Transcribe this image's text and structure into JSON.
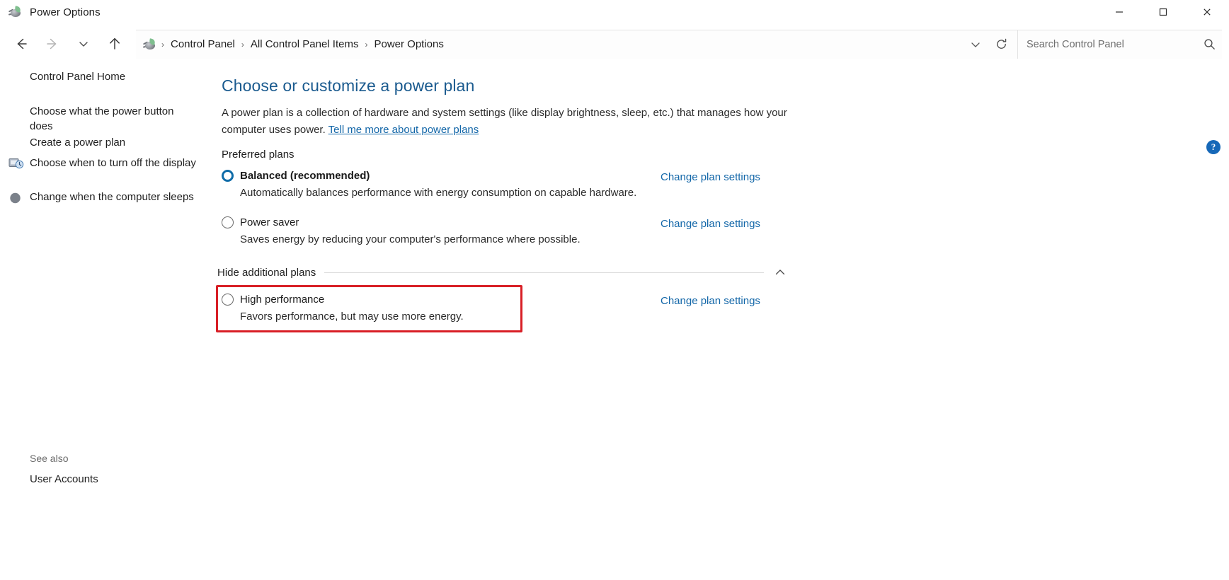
{
  "window": {
    "title": "Power Options",
    "app_icon": "power-plug-icon",
    "controls": {
      "minimize": "—",
      "maximize": "☐",
      "close": "✕"
    }
  },
  "navbar": {
    "back": "back-arrow",
    "forward": "forward-arrow",
    "recent": "chevron-down",
    "up": "up-arrow",
    "breadcrumbs": [
      "Control Panel",
      "All Control Panel Items",
      "Power Options"
    ],
    "separator": "›",
    "history_dropdown": "chevron-down",
    "refresh": "refresh-icon"
  },
  "search": {
    "placeholder": "Search Control Panel",
    "value": "",
    "icon": "search-icon"
  },
  "sidebar": {
    "home": "Control Panel Home",
    "items": [
      {
        "label": "Choose what the power button does",
        "icon": null
      },
      {
        "label": "Create a power plan",
        "icon": null
      },
      {
        "label": "Choose when to turn off the display",
        "icon": "display-shield-icon"
      },
      {
        "label": "Change when the computer sleeps",
        "icon": "moon-icon"
      }
    ],
    "see_also_label": "See also",
    "see_also_links": [
      "User Accounts"
    ]
  },
  "main": {
    "title": "Choose or customize a power plan",
    "description_prefix": "A power plan is a collection of hardware and system settings (like display brightness, sleep, etc.) that manages how your computer uses power. ",
    "description_link": "Tell me more about power plans",
    "preferred_plans_label": "Preferred plans",
    "plans": [
      {
        "name": "Balanced (recommended)",
        "description": "Automatically balances performance with energy consumption on capable hardware.",
        "selected": true,
        "bold": true,
        "action": "Change plan settings"
      },
      {
        "name": "Power saver",
        "description": "Saves energy by reducing your computer's performance where possible.",
        "selected": false,
        "bold": false,
        "action": "Change plan settings"
      }
    ],
    "additional_toggle": {
      "label": "Hide additional plans",
      "icon": "chevron-up-icon"
    },
    "additional_plans": [
      {
        "name": "High performance",
        "description": "Favors performance, but may use more energy.",
        "selected": false,
        "bold": false,
        "action": "Change plan settings",
        "highlighted": true
      }
    ],
    "help_button": "?"
  },
  "colors": {
    "title_blue": "#1b5b8f",
    "link_blue": "#1266a8",
    "radio_selected": "#0f6ca8",
    "highlight_red": "#d81f26",
    "help_blue": "#1668b8"
  }
}
